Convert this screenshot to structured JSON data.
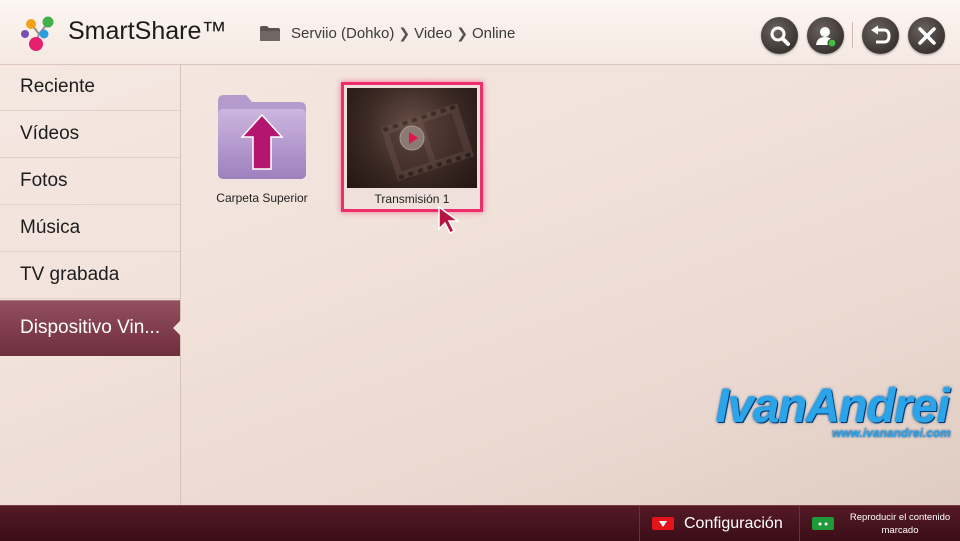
{
  "header": {
    "app_title": "SmartShare™",
    "breadcrumb": [
      "Serviio (Dohko)",
      "Video",
      "Online"
    ],
    "buttons": [
      {
        "name": "search",
        "icon": "search-icon"
      },
      {
        "name": "profile",
        "icon": "user-icon"
      },
      {
        "name": "back",
        "icon": "back-arrow-icon"
      },
      {
        "name": "close",
        "icon": "close-icon"
      }
    ]
  },
  "sidebar": {
    "items": [
      {
        "label": "Reciente"
      },
      {
        "label": "Vídeos"
      },
      {
        "label": "Fotos"
      },
      {
        "label": "Música"
      },
      {
        "label": "TV grabada"
      },
      {
        "label": "Dispositivo Vin...",
        "active": true
      }
    ]
  },
  "content": {
    "items": [
      {
        "label": "Carpeta Superior",
        "icon": "parent-folder-icon"
      },
      {
        "label": "Transmisión 1",
        "icon": "video-thumbnail",
        "selected": true
      }
    ]
  },
  "watermark": {
    "title": "IvanAndrei",
    "url": "www.ivanandrei.com"
  },
  "footer": {
    "config_label": "Configuración",
    "config_key_color": "#e3141b",
    "play_marked_label_line1": "Reproducir el contenido",
    "play_marked_label_line2": "marcado",
    "play_key_color": "#1f9a3a"
  },
  "colors": {
    "accent_selection": "#ec2f6b",
    "sidebar_active": "#7a3444",
    "footer_bg": "#4a1420"
  }
}
